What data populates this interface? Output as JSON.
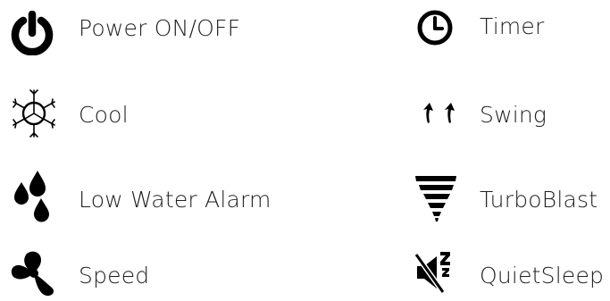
{
  "legend": {
    "power": {
      "label": "Power ON/OFF",
      "icon": "power-icon"
    },
    "cool": {
      "label": "Cool",
      "icon": "snowflake-cool-icon"
    },
    "low_water_alarm": {
      "label": "Low Water Alarm",
      "icon": "water-drops-icon"
    },
    "speed": {
      "label": "Speed",
      "icon": "fan-icon"
    },
    "timer": {
      "label": "Timer",
      "icon": "clock-timer-icon"
    },
    "swing": {
      "label": "Swing",
      "icon": "swing-arrows-icon"
    },
    "turbo_blast": {
      "label": "TurboBlast",
      "icon": "tornado-icon"
    },
    "quiet_sleep": {
      "label": "QuietSleep",
      "icon": "mute-sleep-icon"
    }
  },
  "colors": {
    "icon": "#000000",
    "text": "#1f1f1f",
    "background": "#ffffff"
  }
}
